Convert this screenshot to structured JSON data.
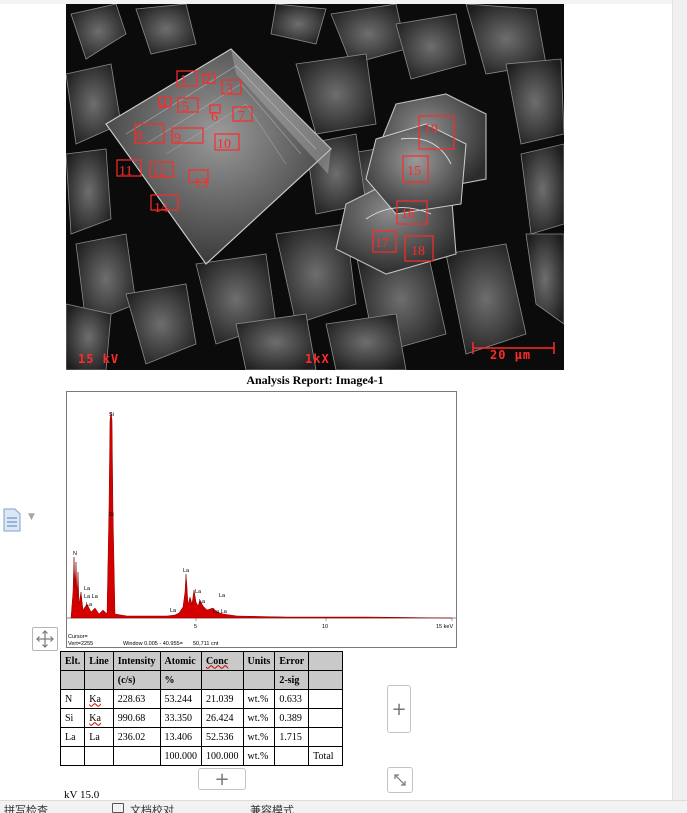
{
  "sem_image": {
    "kv_label": "15 kV",
    "mag_label": "1kX",
    "scale_label": "20 μm",
    "regions": [
      "1",
      "2",
      "3",
      "4",
      "5",
      "6",
      "7",
      "8",
      "9",
      "10",
      "11",
      "12",
      "13",
      "14",
      "15",
      "16",
      "17",
      "18",
      "19"
    ]
  },
  "report_title": "Analysis Report: Image4-1",
  "spectrum": {
    "peaks": {
      "si_top": "Si",
      "si_mid": "Si",
      "n": "N",
      "la_a": "La",
      "la_b": "La La",
      "la_c": "La",
      "la_d": "La",
      "la_e": "La",
      "la_f": "La",
      "la_g": "La",
      "la_h": "La",
      "la_i": "La La"
    },
    "x_ticks": [
      "5",
      "10",
      "15 keV"
    ],
    "cursor_label": "Cursor=",
    "vert_label": "Vert=2255",
    "window_label": "Window 0.005 - 40.955=",
    "count_label": "50,711 cnt"
  },
  "table": {
    "headers": [
      {
        "main": "Elt.",
        "sub": ""
      },
      {
        "main": "Line",
        "sub": ""
      },
      {
        "main": "Intensity",
        "sub": "(c/s)"
      },
      {
        "main": "Atomic",
        "sub": "%"
      },
      {
        "main": "Conc",
        "sub": ""
      },
      {
        "main": "Units",
        "sub": ""
      },
      {
        "main": "Error",
        "sub": "2-sig"
      },
      {
        "main": "",
        "sub": ""
      }
    ],
    "rows": [
      [
        "N",
        "Ka",
        "228.63",
        "53.244",
        "21.039",
        "wt.%",
        "0.633",
        ""
      ],
      [
        "Si",
        "Ka",
        "990.68",
        "33.350",
        "26.424",
        "wt.%",
        "0.389",
        ""
      ],
      [
        "La",
        "La",
        "236.02",
        "13.406",
        "52.536",
        "wt.%",
        "1.715",
        ""
      ],
      [
        "",
        "",
        "",
        "100.000",
        "100.000",
        "wt.%",
        "",
        "Total"
      ]
    ]
  },
  "controls": {
    "move_icon": "move-arrows-icon",
    "add_col_label": "+",
    "add_row_label": "+",
    "resize_icon": "resize-diagonal-icon"
  },
  "footer": {
    "kv_text": "kV   15.0"
  },
  "statusbar": {
    "item1": "拼写检查",
    "item2": "文档校对",
    "item3": "兼容模式"
  },
  "colors": {
    "marker": "#ff2a2a",
    "spectrum_fill": "#d40000",
    "table_header": "#c9c9c9"
  }
}
